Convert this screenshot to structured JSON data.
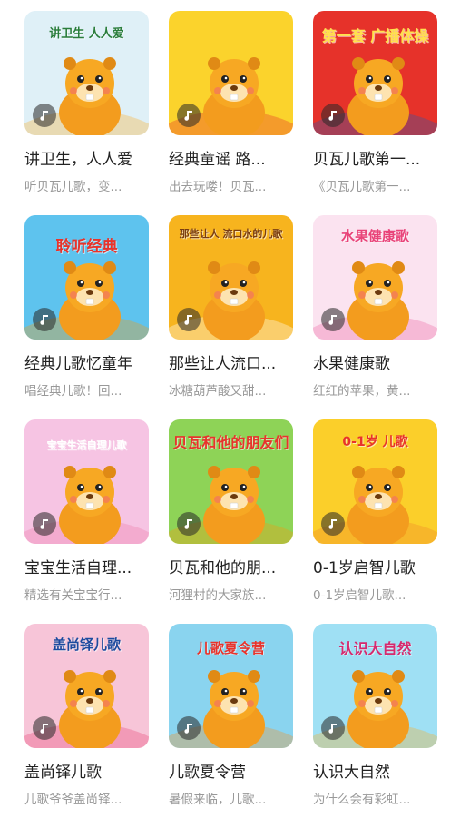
{
  "albums": [
    {
      "title": "讲卫生，人人爱",
      "desc": "听贝瓦儿歌，变...",
      "cover_text": "讲卫生 人人爱",
      "bg": "#dff0f7",
      "accent": "#f9b233"
    },
    {
      "title": "经典童谣 路...",
      "desc": "出去玩喽！贝瓦...",
      "cover_text": "",
      "bg": "#fbd32c",
      "accent": "#e8332b"
    },
    {
      "title": "贝瓦儿歌第一...",
      "desc": "《贝瓦儿歌第一...",
      "cover_text": "第一套 广播体操",
      "bg": "#e6322a",
      "accent": "#2b5aa8"
    },
    {
      "title": "经典儿歌忆童年",
      "desc": "唱经典儿歌！回...",
      "cover_text": "聆听经典",
      "bg": "#5ec3ee",
      "accent": "#f39c12"
    },
    {
      "title": "那些让人流口...",
      "desc": "冰糖葫芦酸又甜...",
      "cover_text": "那些让人 流口水的儿歌",
      "bg": "#f7b41e",
      "accent": "#ffffff"
    },
    {
      "title": "水果健康歌",
      "desc": "红红的苹果，黄...",
      "cover_text": "水果健康歌",
      "bg": "#fbe3f0",
      "accent": "#ee6aa7"
    },
    {
      "title": "宝宝生活自理...",
      "desc": "精选有关宝宝行...",
      "cover_text": "宝宝生活自理儿歌",
      "bg": "#f6c4e3",
      "accent": "#ef7fa8"
    },
    {
      "title": "贝瓦和他的朋...",
      "desc": "河狸村的大家族...",
      "cover_text": "贝瓦和他的朋友们",
      "bg": "#8ed357",
      "accent": "#f39c12"
    },
    {
      "title": "0-1岁启智儿歌",
      "desc": "0-1岁启智儿歌...",
      "cover_text": "0-1岁 儿歌",
      "bg": "#fbcf2a",
      "accent": "#f0872b"
    },
    {
      "title": "盖尚铎儿歌",
      "desc": "儿歌爷爷盖尚铎...",
      "cover_text": "盖尚铎儿歌",
      "bg": "#f7c5d8",
      "accent": "#e94b7a"
    },
    {
      "title": "儿歌夏令营",
      "desc": "暑假来临，儿歌...",
      "cover_text": "儿歌夏令营",
      "bg": "#8ad4ef",
      "accent": "#f0932b"
    },
    {
      "title": "认识大自然",
      "desc": "为什么会有彩虹...",
      "cover_text": "认识大自然",
      "bg": "#9fe0f4",
      "accent": "#f7b02d"
    }
  ]
}
